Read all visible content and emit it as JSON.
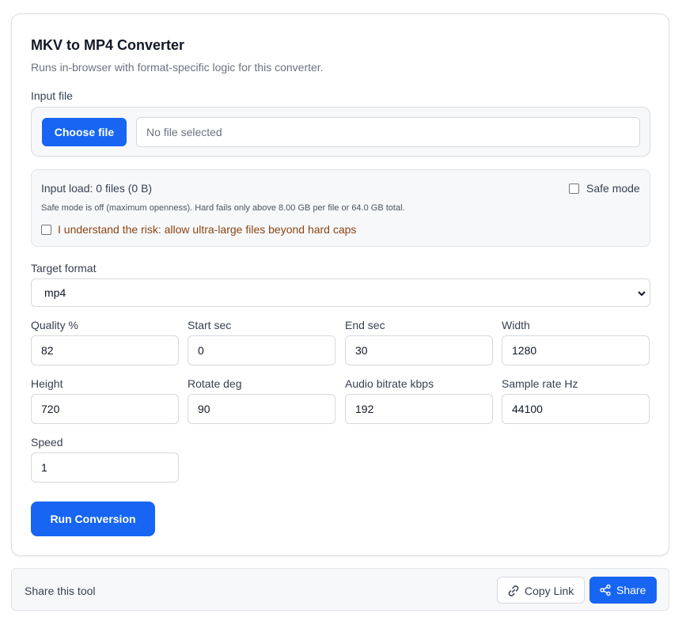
{
  "converter": {
    "title": "MKV to MP4 Converter",
    "subtitle": "Runs in-browser with format-specific logic for this converter.",
    "input_file_label": "Input file",
    "choose_file_label": "Choose file",
    "file_status": "No file selected"
  },
  "load": {
    "text": "Input load: 0 files (0 B)",
    "note": "Safe mode is off (maximum openness). Hard fails only above 8.00 GB per file or 64.0 GB total.",
    "safe_mode_label": "Safe mode",
    "safe_mode_checked": false,
    "risk_label": "I understand the risk: allow ultra-large files beyond hard caps",
    "risk_checked": false
  },
  "target_format": {
    "label": "Target format",
    "selected": "mp4"
  },
  "fields": {
    "quality": {
      "label": "Quality %",
      "value": "82"
    },
    "start_sec": {
      "label": "Start sec",
      "value": "0"
    },
    "end_sec": {
      "label": "End sec",
      "value": "30"
    },
    "width": {
      "label": "Width",
      "value": "1280"
    },
    "height": {
      "label": "Height",
      "value": "720"
    },
    "rotate_deg": {
      "label": "Rotate deg",
      "value": "90"
    },
    "audio_bitrate": {
      "label": "Audio bitrate kbps",
      "value": "192"
    },
    "sample_rate": {
      "label": "Sample rate Hz",
      "value": "44100"
    },
    "speed": {
      "label": "Speed",
      "value": "1"
    }
  },
  "run_button_label": "Run Conversion",
  "share": {
    "text": "Share this tool",
    "copy_link_label": "Copy Link",
    "copy_link_icon": "link-icon",
    "share_label": "Share",
    "share_icon": "share-icon"
  },
  "colors": {
    "primary": "#1765f2",
    "warning_text": "#8b4513"
  }
}
